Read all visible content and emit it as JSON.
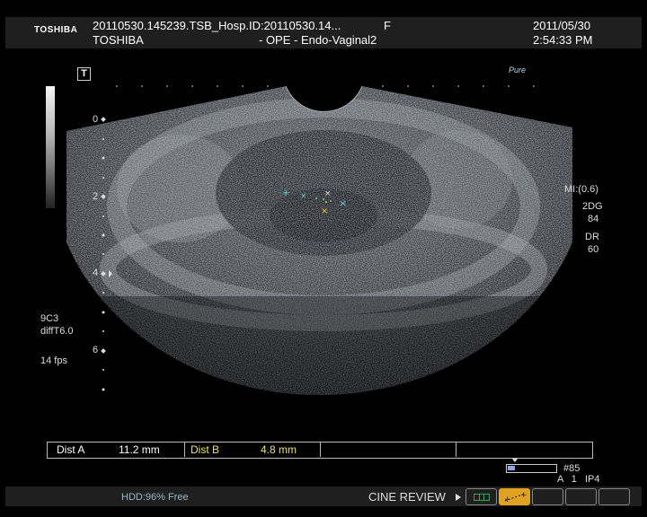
{
  "header": {
    "brand": "TOSHIBA",
    "study_id": "20110530.145239.TSB_Hosp.ID:20110530.14...",
    "sex": "F",
    "date": "2011/05/30",
    "manufacturer": "TOSHIBA",
    "mode": "- OPE -   Endo-Vaginal2",
    "time": "2:54:33 PM"
  },
  "markers": {
    "orientation": "T",
    "pure_logo": "Pure"
  },
  "depth_scale": [
    "0",
    "2",
    "4",
    "6"
  ],
  "right_panel": {
    "mi": "MI:(0.6)",
    "mode_2d": "2DG",
    "gain": "84",
    "dr_label": "DR",
    "dr_value": "60"
  },
  "left_panel": {
    "probe": "9C3",
    "preset": "diffT6.0",
    "frame_rate": "14 fps"
  },
  "measurements": {
    "dist_a_label": "Dist  A",
    "dist_a_value": "11.2  mm",
    "dist_b_label": "Dist  B",
    "dist_b_value": "4.8  mm"
  },
  "thumbnail": {
    "frame": "#85",
    "params": "A 1  IP4"
  },
  "footer": {
    "hdd": "HDD:96% Free",
    "cine": "CINE REVIEW"
  },
  "colors": {
    "header_bg": "#1f1f1f",
    "dist_a": "#ffffff",
    "dist_b": "#e8e070",
    "caliper_a": "#4fd2d2",
    "caliper_b": "#e0c040",
    "footer_active": "#e0a020",
    "footer_green": "#2ea84a"
  }
}
